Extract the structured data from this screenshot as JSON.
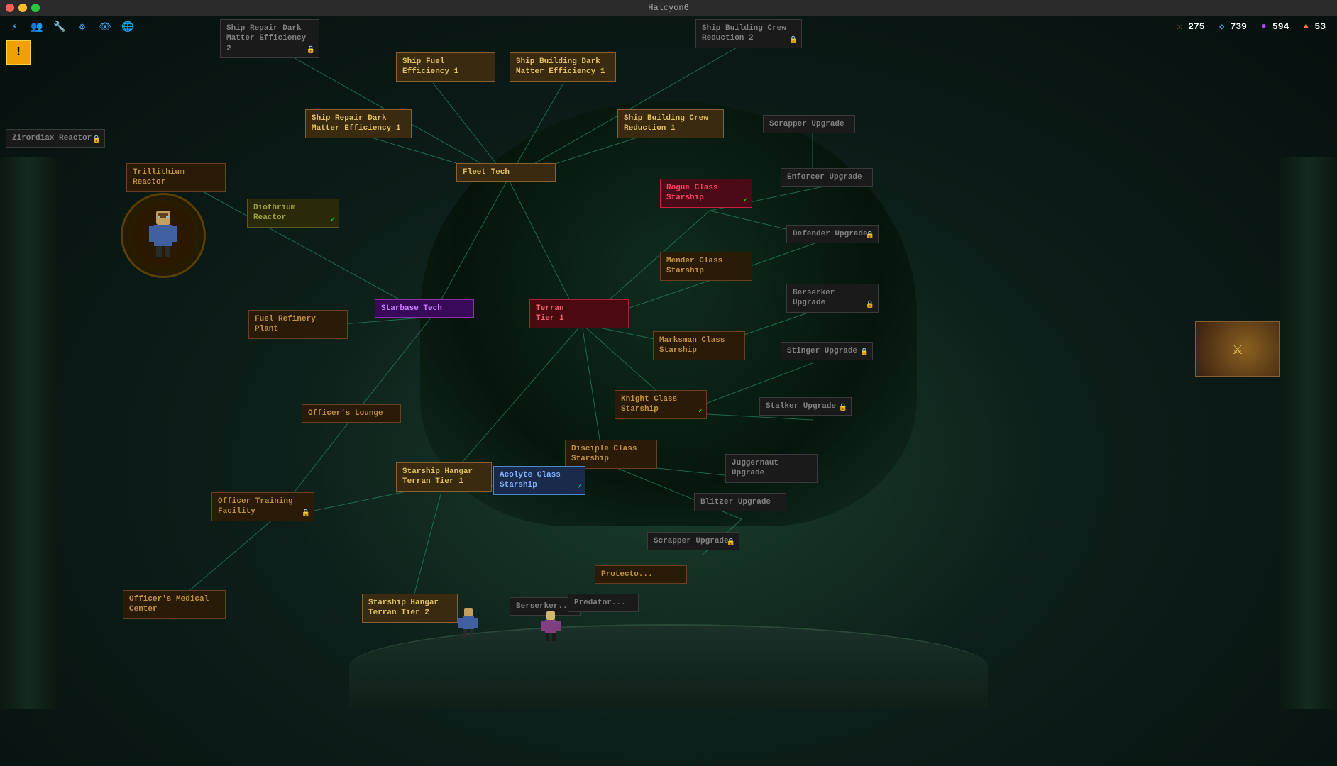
{
  "titleBar": {
    "title": "Halcyon6",
    "closeBtn": "●",
    "minBtn": "●",
    "maxBtn": "●"
  },
  "hud": {
    "resource1Icon": "⚔",
    "resource1Value": "275",
    "resource2Icon": "◇",
    "resource2Value": "739",
    "resource3Icon": "●",
    "resource3Value": "594",
    "resource4Icon": "▲",
    "resource4Value": "53"
  },
  "leftIcons": [
    "⚡",
    "👥",
    "🔧",
    "⚙",
    "👁",
    "🌐"
  ],
  "nodes": {
    "matterEfficiency2": "Ship Repair Dark\nMatter Efficiency 2",
    "crewReduction2": "Ship Building Crew\nReduction 2",
    "fuelEfficiency1": "Ship Fuel\nEfficiency 1",
    "buildingDarkMatter1": "Ship Building Dark\nMatter Efficiency 1",
    "repairDarkMatter1": "Ship Repair Dark\nMatter Efficiency 1",
    "crewReduction1": "Ship Building Crew\nReduction 1",
    "scrapperUpgrade1": "Scrapper Upgrade",
    "fleetTech": "Fleet Tech",
    "rogueClass": "Rogue Class\nStarship",
    "enforcerUpgrade": "Enforcer Upgrade",
    "trillithiumReactor": "Trillithium Reactor",
    "diothiumReactor": "Diothrium Reactor",
    "defenderUpgrade": "Defender Upgrade",
    "menderClass": "Mender Class\nStarship",
    "berserkerUpgrade": "Berserker\nUpgrade",
    "starbaseTech": "Starbase Tech",
    "terranTier1": "Terran\nTier 1",
    "fuelRefinery": "Fuel Refinery Plant",
    "marksmanClass": "Marksman Class\nStarship",
    "stingerUpgrade": "Stinger Upgrade",
    "officerLounge": "Officer's Lounge",
    "stalkerUpgrade": "Stalker Upgrade",
    "knightClass": "Knight Class\nStarship",
    "discipleClass": "Disciple Class\nStarship",
    "juggernutUpgrade": "Juggernaut\nUpgrade",
    "starshipHangarT1": "Starship Hangar\nTerran Tier 1",
    "acolyteClass": "Acolyte Class\nStarship",
    "blitzerUpgrade": "Blitzer Upgrade",
    "officerTraining": "Officer Training\nFacility",
    "scrapperUpgrade2": "Scrapper Upgrade",
    "zirordiaxReactor": "Zirordiax Reactor",
    "officerMedical": "Officer's Medical\nCenter",
    "starshipHangarT2": "Starship Hangar\nTerran Tier 2",
    "predator": "Predator",
    "protecto": "Protecto..."
  }
}
